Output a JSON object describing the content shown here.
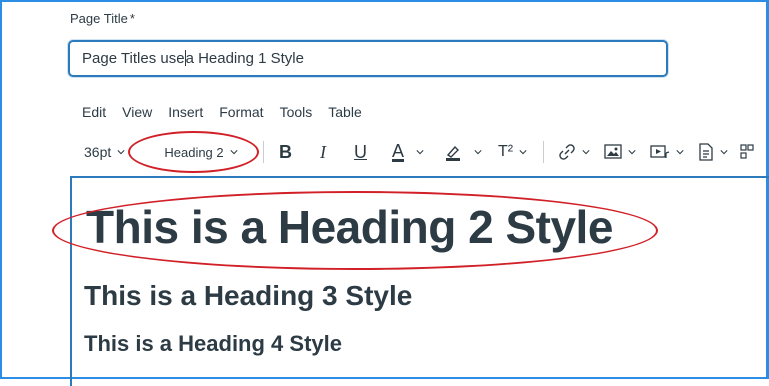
{
  "title_field": {
    "label": "Page Title",
    "required_mark": "*",
    "value_before_caret": "Page Titles use",
    "value_after_caret": "a Heading 1 Style"
  },
  "menu": {
    "items": [
      "Edit",
      "View",
      "Insert",
      "Format",
      "Tools",
      "Table"
    ]
  },
  "toolbar": {
    "font_size": "36pt",
    "block_format": "Heading 2",
    "bold": "B",
    "italic": "I",
    "underline": "U",
    "text_color": "A",
    "superscript": "T²"
  },
  "content": {
    "heading2": "This is a Heading 2 Style",
    "heading3": "This is a Heading 3 Style",
    "heading4": "This is a Heading 4 Style"
  },
  "colors": {
    "accent_border": "#2b7abc",
    "frame_border": "#2b8de4",
    "annotation_red": "#d12027",
    "text": "#2d3b45"
  },
  "icons": [
    "chevron-down-icon",
    "highlight-icon",
    "link-icon",
    "image-icon",
    "media-icon",
    "document-icon",
    "more-icon"
  ]
}
